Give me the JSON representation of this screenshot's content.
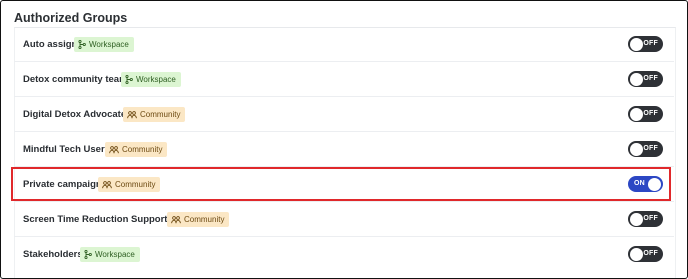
{
  "section": {
    "title": "Authorized Groups"
  },
  "colors": {
    "workspace_badge_bg": "#dcf5d2",
    "community_badge_bg": "#fbe7c5",
    "toggle_on": "#2c47c4",
    "toggle_off": "#2e3136",
    "highlight_border": "#e0282b"
  },
  "groups": [
    {
      "name": "Auto assign",
      "type": "Workspace",
      "type_icon": "branch-icon",
      "toggle": "OFF",
      "enabled": false
    },
    {
      "name": "Detox community team",
      "type": "Workspace",
      "type_icon": "branch-icon",
      "toggle": "OFF",
      "enabled": false
    },
    {
      "name": "Digital Detox Advocates",
      "type": "Community",
      "type_icon": "people-icon",
      "toggle": "OFF",
      "enabled": false
    },
    {
      "name": "Mindful Tech Users",
      "type": "Community",
      "type_icon": "people-icon",
      "toggle": "OFF",
      "enabled": false
    },
    {
      "name": "Private campaign",
      "type": "Community",
      "type_icon": "people-icon",
      "toggle": "ON",
      "enabled": true,
      "highlighted": true
    },
    {
      "name": "Screen Time Reduction Supporters",
      "type": "Community",
      "type_icon": "people-icon",
      "toggle": "OFF",
      "enabled": false
    },
    {
      "name": "Stakeholders",
      "type": "Workspace",
      "type_icon": "branch-icon",
      "toggle": "OFF",
      "enabled": false
    }
  ]
}
